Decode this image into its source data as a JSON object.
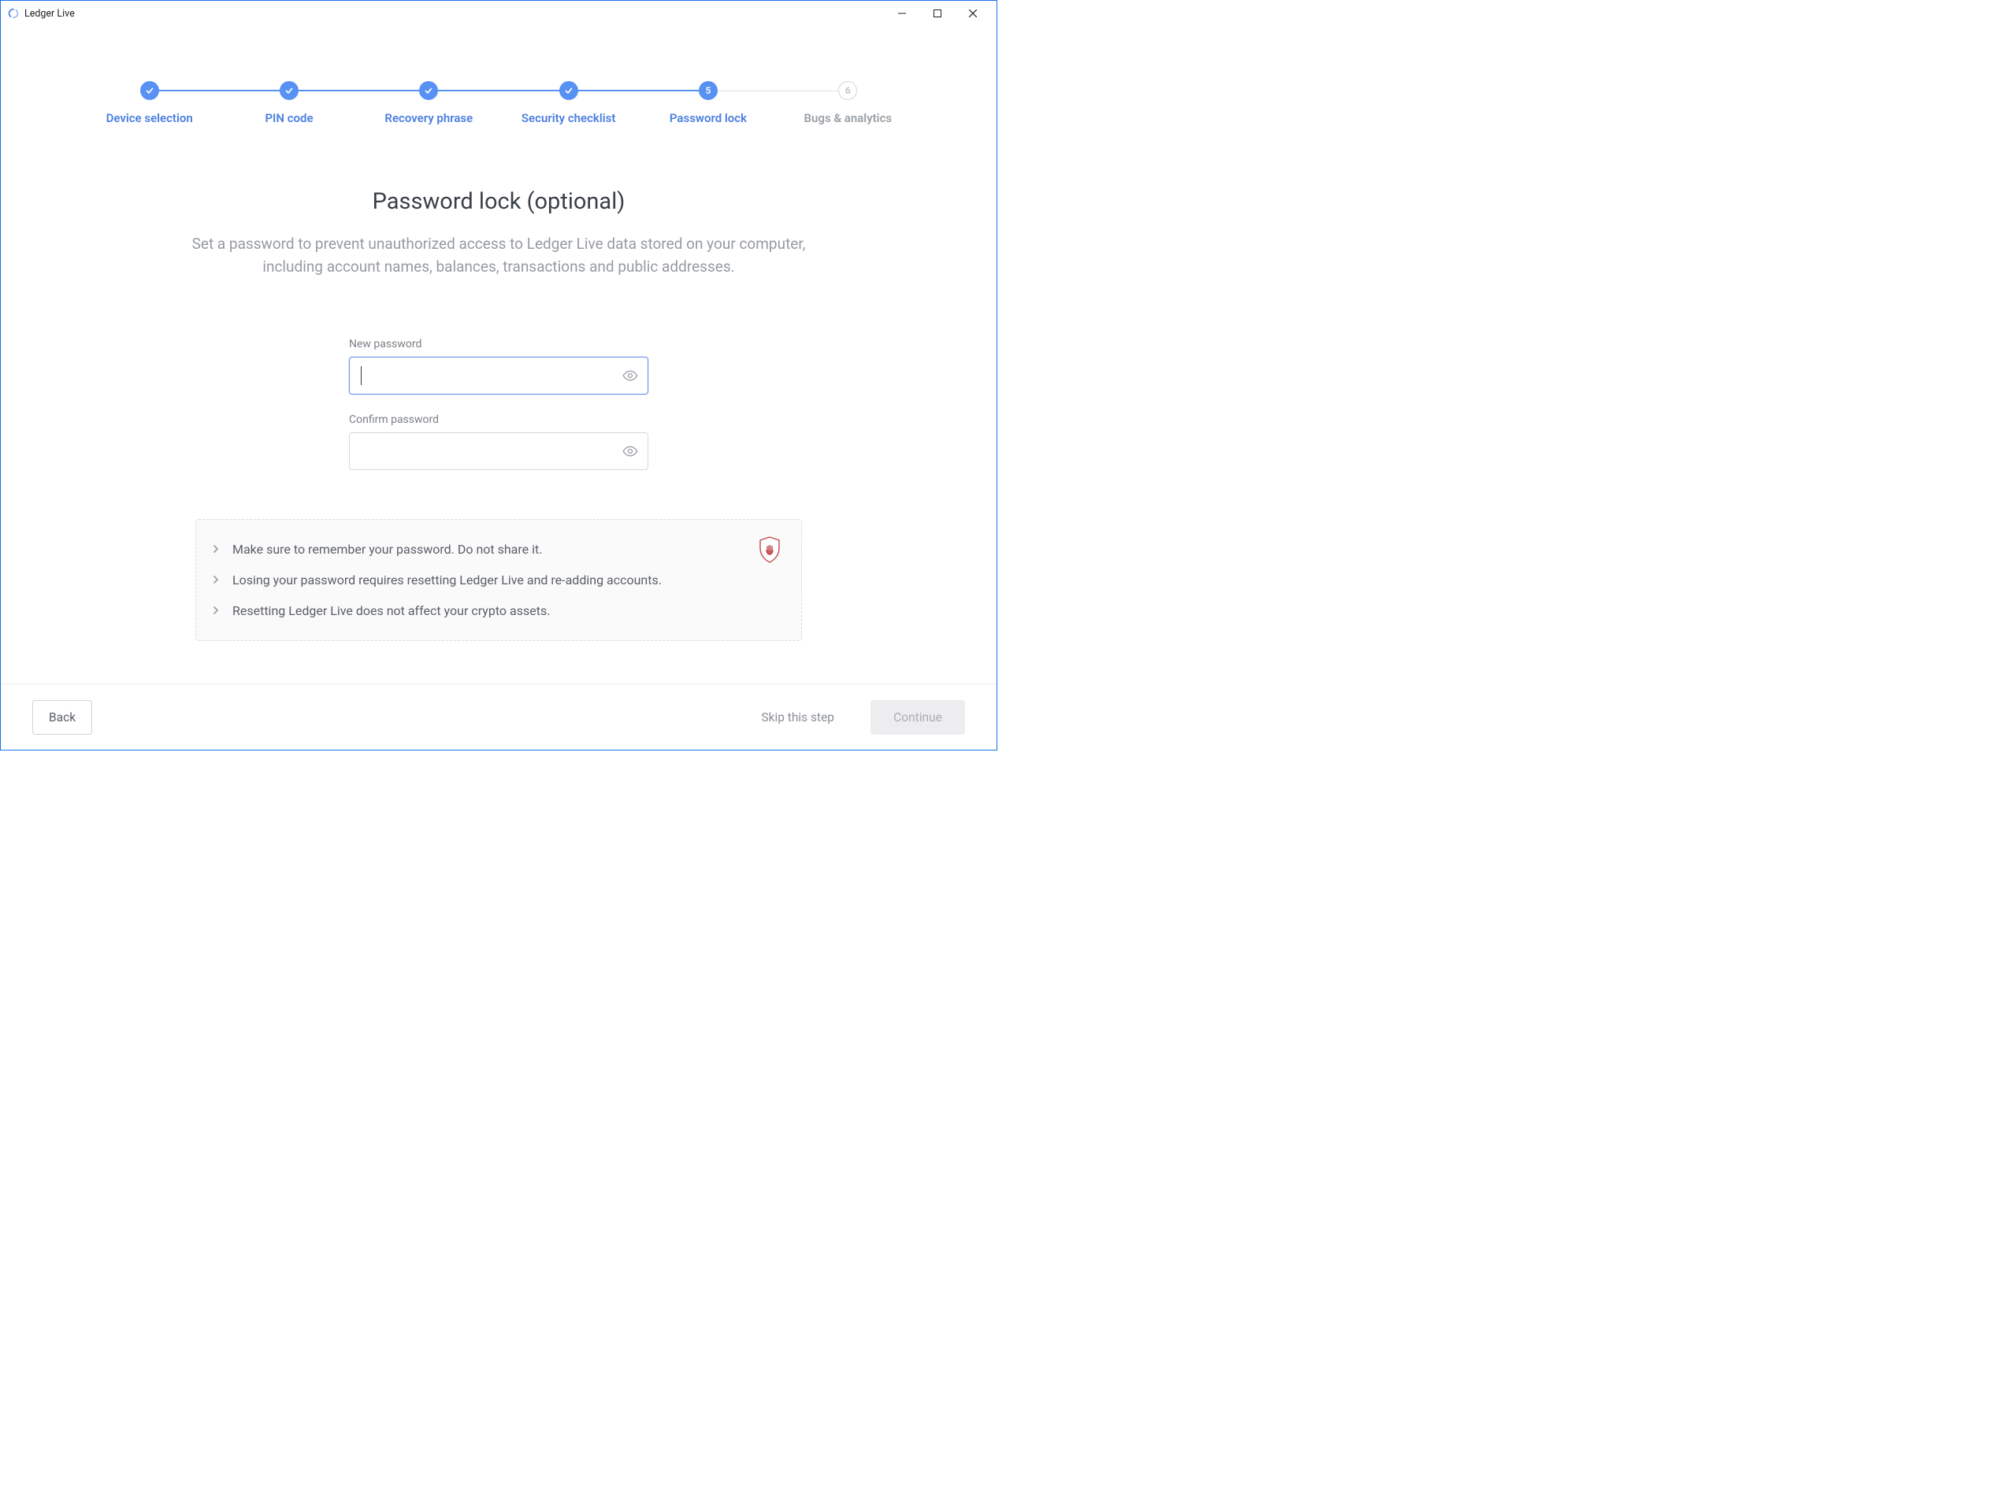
{
  "window": {
    "title": "Ledger Live"
  },
  "stepper": {
    "steps": [
      {
        "label": "Device selection",
        "state": "done"
      },
      {
        "label": "PIN code",
        "state": "done"
      },
      {
        "label": "Recovery phrase",
        "state": "done"
      },
      {
        "label": "Security checklist",
        "state": "done"
      },
      {
        "label": "Password lock",
        "state": "active",
        "number": "5"
      },
      {
        "label": "Bugs & analytics",
        "state": "pending",
        "number": "6"
      }
    ]
  },
  "page": {
    "title": "Password lock (optional)",
    "description": "Set a password to prevent unauthorized access to Ledger Live data stored on your computer, including account names, balances, transactions and public addresses."
  },
  "form": {
    "new_password": {
      "label": "New password",
      "value": ""
    },
    "confirm_password": {
      "label": "Confirm password",
      "value": ""
    }
  },
  "warnings": [
    "Make sure to remember your password. Do not share it.",
    "Losing your password requires resetting Ledger Live and re-adding accounts.",
    "Resetting Ledger Live does not affect your crypto assets."
  ],
  "footer": {
    "back": "Back",
    "skip": "Skip this step",
    "continue": "Continue"
  }
}
